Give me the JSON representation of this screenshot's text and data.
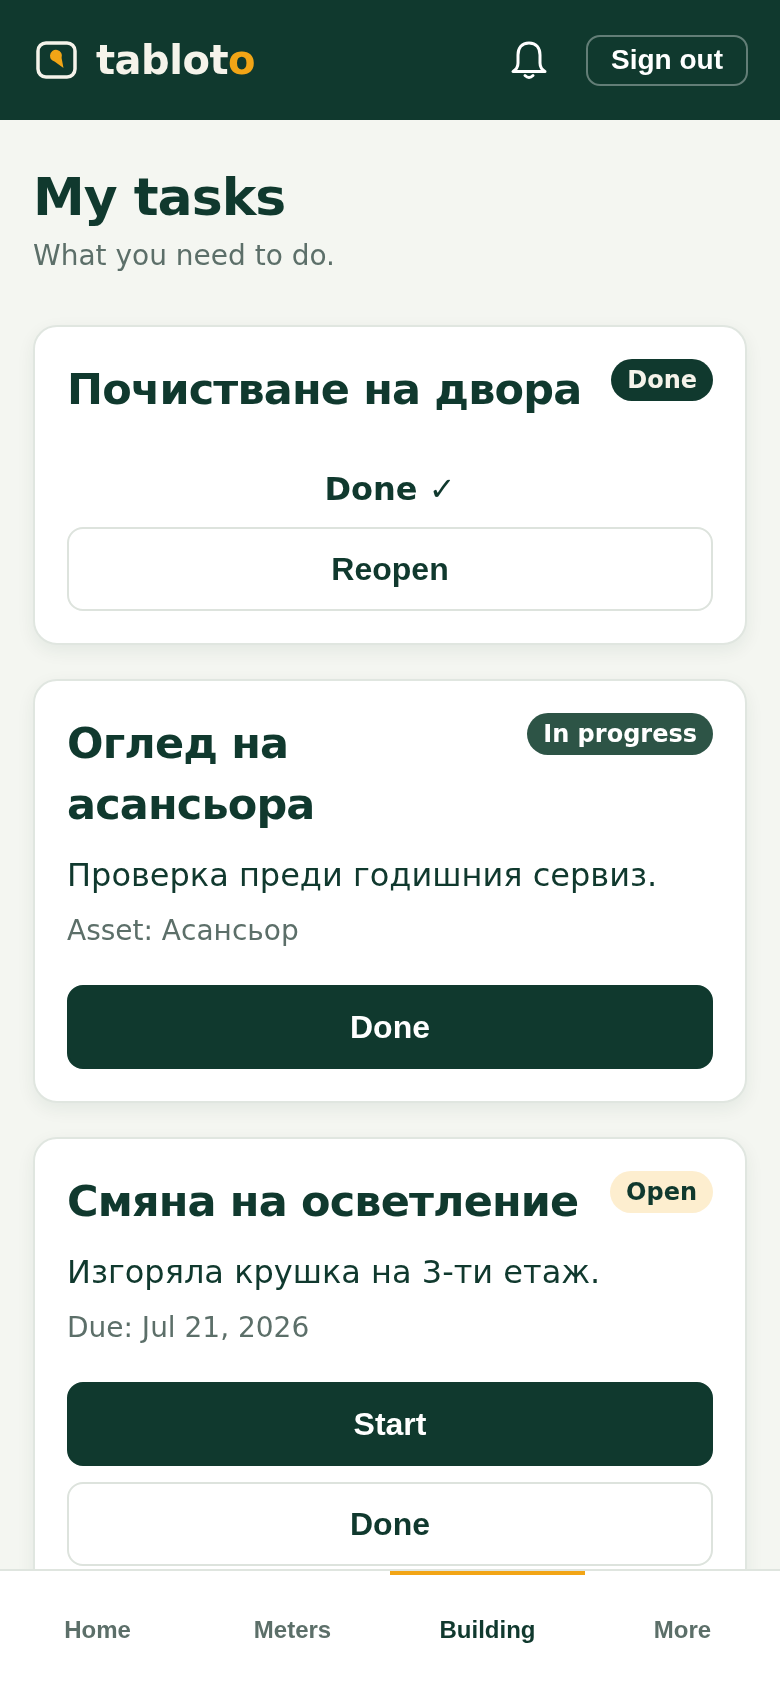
{
  "header": {
    "logo": {
      "text": "tablot",
      "accent": "o"
    },
    "sign_out": "Sign out"
  },
  "page": {
    "title": "My tasks",
    "subtitle": "What you need to do."
  },
  "tasks": [
    {
      "title": "Почистване на двора",
      "badge": {
        "label": "Done",
        "kind": "done"
      },
      "actions": [
        {
          "kind": "note",
          "label": "Done ✓"
        },
        {
          "kind": "secondary",
          "label": "Reopen"
        }
      ]
    },
    {
      "title": "Оглед на асансьора",
      "badge": {
        "label": "In progress",
        "kind": "in_progress"
      },
      "description": "Проверка преди годишния сервиз.",
      "meta": "Asset: Асансьор",
      "actions": [
        {
          "kind": "primary",
          "label": "Done"
        }
      ]
    },
    {
      "title": "Смяна на осветление",
      "badge": {
        "label": "Open",
        "kind": "open"
      },
      "description": "Изгоряла крушка на 3-ти етаж.",
      "meta": "Due: Jul 21, 2026",
      "actions": [
        {
          "kind": "primary",
          "label": "Start"
        },
        {
          "kind": "secondary",
          "label": "Done"
        }
      ]
    }
  ],
  "bottom_nav": {
    "tabs": [
      {
        "label": "Home",
        "selected": false
      },
      {
        "label": "Meters",
        "selected": false
      },
      {
        "label": "Building",
        "selected": true
      },
      {
        "label": "More",
        "selected": false
      }
    ]
  }
}
